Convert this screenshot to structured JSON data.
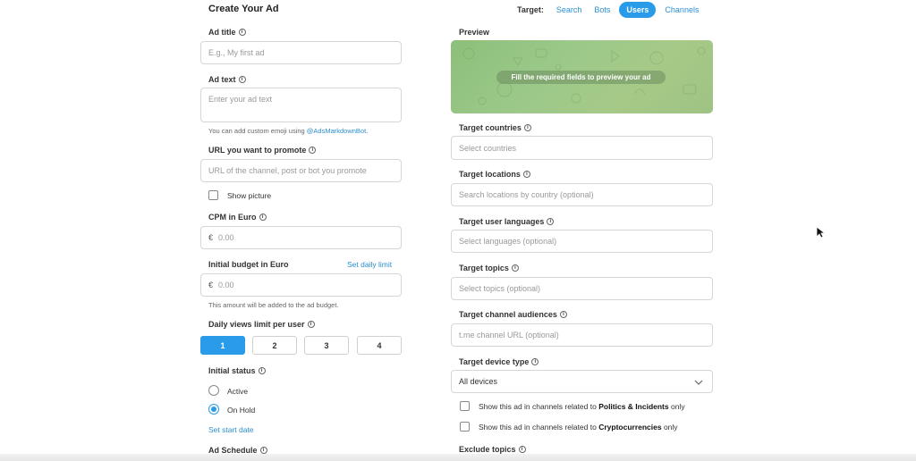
{
  "header": {
    "title": "Create Your Ad",
    "target_label": "Target:",
    "tabs": [
      {
        "label": "Search",
        "active": false
      },
      {
        "label": "Bots",
        "active": false
      },
      {
        "label": "Users",
        "active": true
      },
      {
        "label": "Channels",
        "active": false
      }
    ]
  },
  "left": {
    "ad_title": {
      "label": "Ad title",
      "placeholder": "E.g., My first ad"
    },
    "ad_text": {
      "label": "Ad text",
      "placeholder": "Enter your ad text",
      "hint_prefix": "You can add custom emoji using ",
      "hint_link": "@AdsMarkdownBot",
      "hint_suffix": "."
    },
    "url": {
      "label": "URL you want to promote",
      "placeholder": "URL of the channel, post or bot you promote"
    },
    "show_picture": {
      "label": "Show picture",
      "checked": false
    },
    "cpm": {
      "label": "CPM in Euro",
      "currency": "€",
      "placeholder": "0.00"
    },
    "budget": {
      "label": "Initial budget in Euro",
      "link": "Set daily limit",
      "currency": "€",
      "placeholder": "0.00",
      "hint": "This amount will be added to the ad budget."
    },
    "daily_views": {
      "label": "Daily views limit per user",
      "options": [
        "1",
        "2",
        "3",
        "4"
      ],
      "selected": "1"
    },
    "status": {
      "label": "Initial status",
      "options": [
        "Active",
        "On Hold"
      ],
      "selected": "On Hold",
      "start_date_link": "Set start date"
    },
    "schedule": {
      "label": "Ad Schedule"
    }
  },
  "right": {
    "preview": {
      "label": "Preview",
      "message": "Fill the required fields to preview your ad"
    },
    "countries": {
      "label": "Target countries",
      "placeholder": "Select countries"
    },
    "locations": {
      "label": "Target locations",
      "placeholder": "Search locations by country (optional)"
    },
    "languages": {
      "label": "Target user languages",
      "placeholder": "Select languages (optional)"
    },
    "topics": {
      "label": "Target topics",
      "placeholder": "Select topics (optional)"
    },
    "channel_audiences": {
      "label": "Target channel audiences",
      "placeholder": "t.me channel URL (optional)"
    },
    "device": {
      "label": "Target device type",
      "value": "All devices"
    },
    "politics": {
      "prefix": "Show this ad in channels related to ",
      "bold": "Politics & Incidents",
      "suffix": " only",
      "checked": false
    },
    "crypto": {
      "prefix": "Show this ad in channels related to ",
      "bold": "Cryptocurrencies",
      "suffix": " only",
      "checked": false
    },
    "exclude": {
      "label": "Exclude topics"
    }
  },
  "icons": {
    "info": "ⓘ",
    "chevron": "chevron-down-icon",
    "cursor": "mouse-pointer-icon"
  },
  "colors": {
    "accent": "#2a9be8",
    "link": "#2a8fd0",
    "preview_bg": "#9cc98a"
  }
}
